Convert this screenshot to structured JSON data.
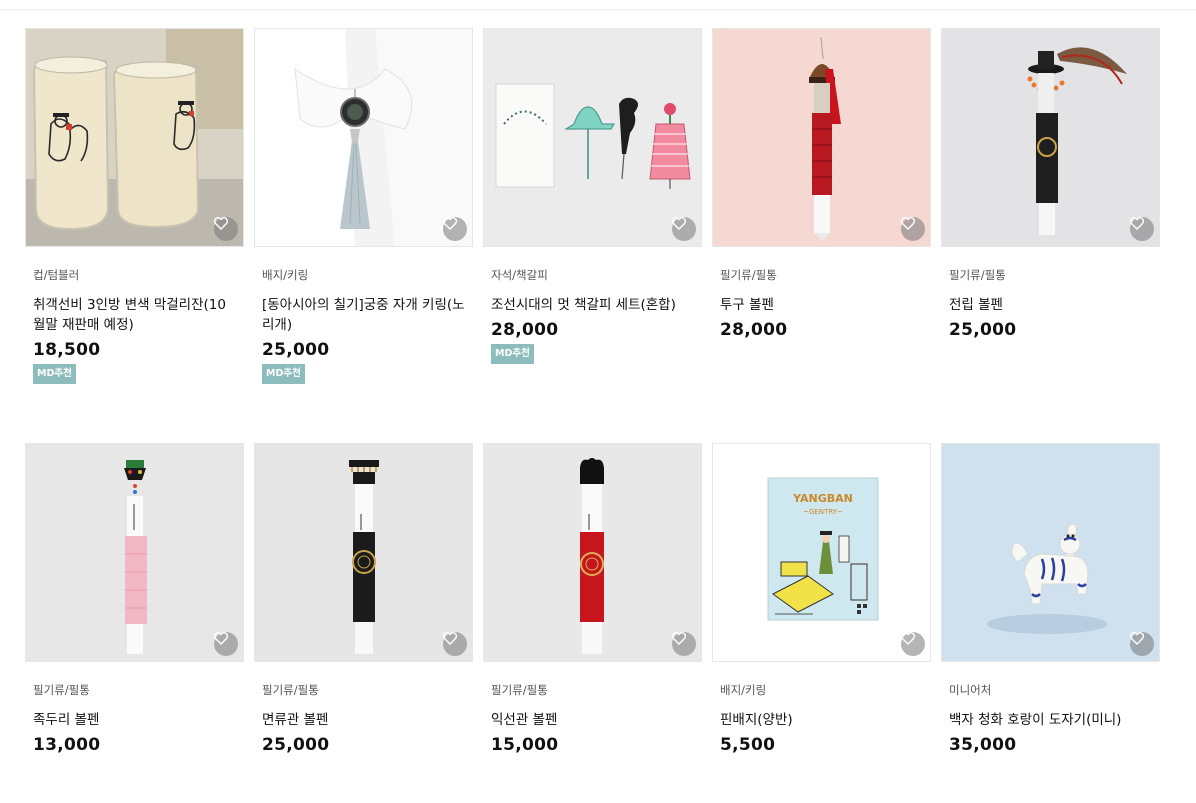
{
  "colors": {
    "badge_bg": "#8dbcbd",
    "wish_button_bg": "#8c8c8c"
  },
  "products": [
    {
      "category": "컵/텀블러",
      "title": "취객선비 3인방 변색 막걸리잔(10월말 재판매 예정)",
      "price": "18,500",
      "badge": "MD추천",
      "icon": "heart-icon"
    },
    {
      "category": "배지/키링",
      "title": "[동아시아의 칠기]궁중 자개 키링(노리개)",
      "price": "25,000",
      "badge": "MD추천",
      "icon": "heart-icon"
    },
    {
      "category": "자석/책갈피",
      "title": "조선시대의 멋 책갈피 세트(혼합)",
      "price": "28,000",
      "badge": "MD추천",
      "icon": "heart-icon"
    },
    {
      "category": "필기류/필통",
      "title": "투구 볼펜",
      "price": "28,000",
      "badge": "",
      "icon": "heart-icon"
    },
    {
      "category": "필기류/필통",
      "title": "전립 볼펜",
      "price": "25,000",
      "badge": "",
      "icon": "heart-icon"
    },
    {
      "category": "필기류/필통",
      "title": "족두리 볼펜",
      "price": "13,000",
      "badge": "",
      "icon": "heart-icon"
    },
    {
      "category": "필기류/필통",
      "title": "면류관 볼펜",
      "price": "25,000",
      "badge": "",
      "icon": "heart-icon"
    },
    {
      "category": "필기류/필통",
      "title": "익선관 볼펜",
      "price": "15,000",
      "badge": "",
      "icon": "heart-icon"
    },
    {
      "category": "배지/키링",
      "title": "핀배지(양반)",
      "price": "5,500",
      "badge": "",
      "icon": "heart-icon"
    },
    {
      "category": "미니어처",
      "title": "백자 청화 호랑이 도자기(미니)",
      "price": "35,000",
      "badge": "",
      "icon": "heart-icon"
    }
  ],
  "pin_badge_art": {
    "line1": "YANGBAN",
    "line2": "~GENTRY~"
  }
}
